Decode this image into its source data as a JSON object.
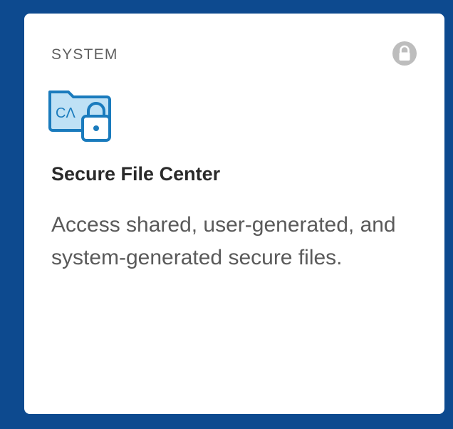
{
  "card": {
    "category": "SYSTEM",
    "title": "Secure File Center",
    "description": "Access shared, user-generated, and system-generated secure files.",
    "badge_icon": "lock-icon",
    "app_icon": "secure-folder-icon",
    "app_icon_text": "CΛ"
  },
  "colors": {
    "background": "#0d4a8f",
    "card": "#ffffff",
    "icon_blue": "#1a7bbd",
    "icon_fill": "#bfe1f5",
    "badge_gray": "#bdbdbd"
  }
}
